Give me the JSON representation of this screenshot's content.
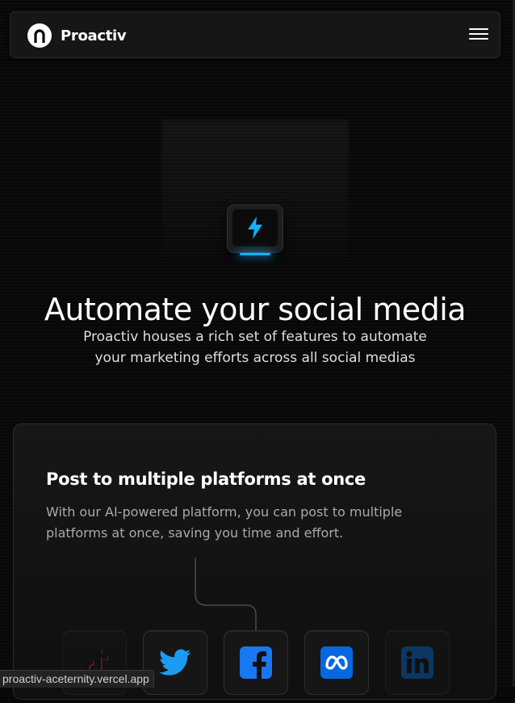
{
  "navbar": {
    "brand_name": "Proactiv",
    "logo_icon": "arch-logo-icon",
    "menu_icon": "hamburger-menu-icon"
  },
  "hero": {
    "icon": "lightning-bolt-icon",
    "accent_color": "#11b1ff",
    "title": "Automate your social media",
    "subtitle": "Proactiv houses a rich set of features to automate your marketing efforts across all social medias"
  },
  "feature_card": {
    "title": "Post to multiple platforms at once",
    "description": "With our AI-powered platform, you can post to multiple platforms at once, saving you time and effort.",
    "platforms": [
      {
        "name": "TikTok",
        "icon": "tiktok-icon"
      },
      {
        "name": "Twitter",
        "icon": "twitter-icon",
        "color": "#1d9bf0"
      },
      {
        "name": "Facebook",
        "icon": "facebook-icon",
        "color": "#1877f2"
      },
      {
        "name": "Meta",
        "icon": "meta-icon",
        "color": "#0668e1"
      },
      {
        "name": "LinkedIn",
        "icon": "linkedin-icon",
        "color": "#0a66c2"
      }
    ]
  },
  "status_bar": {
    "url": "proactiv-aceternity.vercel.app"
  }
}
